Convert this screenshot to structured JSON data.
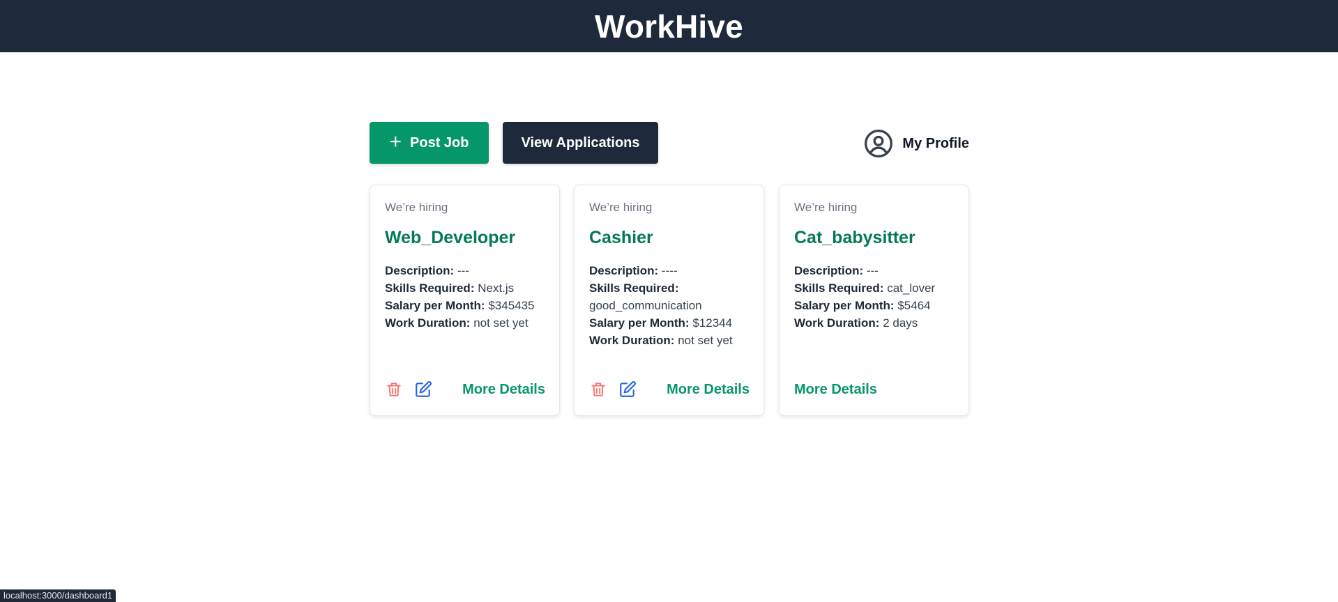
{
  "header": {
    "title": "WorkHive"
  },
  "toolbar": {
    "post_job_label": "Post Job",
    "view_applications_label": "View Applications",
    "profile_label": "My Profile"
  },
  "jobs": [
    {
      "tag": "We’re hiring",
      "title": "Web_Developer",
      "description_label": "Description:",
      "description": "---",
      "skills_label": "Skills Required:",
      "skills": "Next.js",
      "salary_label": "Salary per Month:",
      "salary": "$345435",
      "duration_label": "Work Duration:",
      "duration": "not set yet",
      "more_label": "More Details"
    },
    {
      "tag": "We’re hiring",
      "title": "Cashier",
      "description_label": "Description:",
      "description": "----",
      "skills_label": "Skills Required:",
      "skills": "good_communication",
      "salary_label": "Salary per Month:",
      "salary": "$12344",
      "duration_label": "Work Duration:",
      "duration": "not set yet",
      "more_label": "More Details"
    },
    {
      "tag": "We’re hiring",
      "title": "Cat_babysitter",
      "description_label": "Description:",
      "description": "---",
      "skills_label": "Skills Required:",
      "skills": "cat_lover",
      "salary_label": "Salary per Month:",
      "salary": "$5464",
      "duration_label": "Work Duration:",
      "duration": "2 days",
      "more_label": "More Details"
    }
  ],
  "status_bar": {
    "url": "localhost:3000/dashboard1"
  },
  "colors": {
    "header_bg": "#1e293b",
    "primary_green": "#059669",
    "title_green": "#047857",
    "delete_red": "#f87171",
    "edit_blue": "#2563eb"
  }
}
